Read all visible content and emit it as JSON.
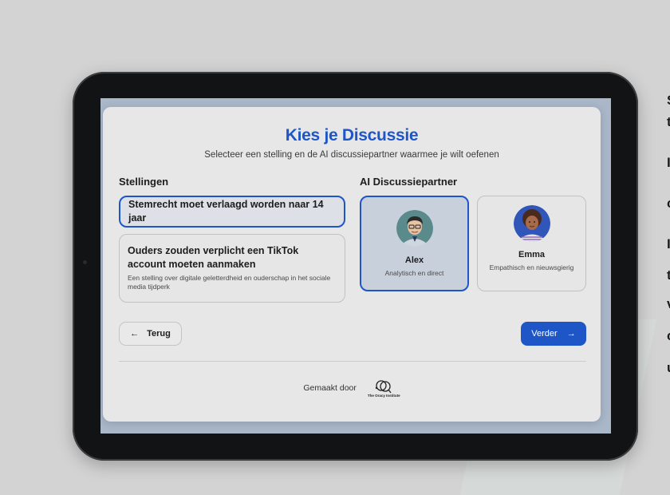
{
  "page": {
    "title": "Kies je Discussie",
    "subtitle": "Selecteer een stelling en de AI discussiepartner waarmee je wilt oefenen"
  },
  "side_text": [
    "S",
    "t",
    "I",
    "c",
    "I",
    "t",
    "v",
    "c",
    "u"
  ],
  "stellingen": {
    "heading": "Stellingen",
    "items": [
      {
        "title": "Stemrecht moet verlaagd worden naar 14 jaar",
        "description": "",
        "selected": true
      },
      {
        "title": "Ouders zouden verplicht een TikTok account moeten aanmaken",
        "description": "Een stelling over digitale geletterdheid en ouderschap in het sociale media tijdperk",
        "selected": false
      }
    ]
  },
  "partners": {
    "heading": "AI Discussiepartner",
    "items": [
      {
        "name": "Alex",
        "description": "Analytisch en direct",
        "selected": true
      },
      {
        "name": "Emma",
        "description": "Empathisch en nieuwsgierig",
        "selected": false
      }
    ]
  },
  "buttons": {
    "back_label": "Terug",
    "next_label": "Verder"
  },
  "footer": {
    "made_by": "Gemaakt door",
    "logo_text": "The Oracy Institute"
  },
  "colors": {
    "accent": "#1e56c8",
    "card_bg": "#e7e7e8",
    "backdrop": "#d3d3d3"
  },
  "icons": {
    "back": "arrow-left-icon",
    "next": "arrow-right-icon",
    "logo": "speech-bubbles-icon"
  }
}
